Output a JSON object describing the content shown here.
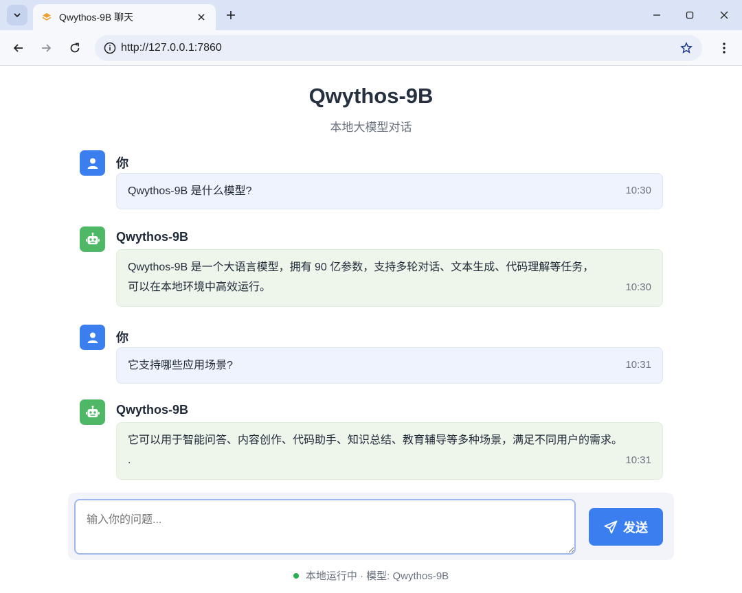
{
  "browser": {
    "tab_title": "Qwythos-9B 聊天",
    "url": "http://127.0.0.1:7860",
    "icons": {
      "tab_menu": "chevron-down-icon",
      "favicon": "layers-icon",
      "tab_close": "close-icon",
      "new_tab": "plus-icon",
      "minimize": "minimize-icon",
      "maximize": "maximize-icon",
      "close_window": "close-icon",
      "back": "arrow-left-icon",
      "forward": "arrow-right-icon",
      "reload": "reload-icon",
      "site_info": "info-icon",
      "bookmark": "star-icon",
      "menu": "more-vertical-icon"
    }
  },
  "header": {
    "title": "Qwythos-9B",
    "subtitle": "本地大模型对话"
  },
  "messages": [
    {
      "role": "user",
      "sender": "你",
      "lines": [
        "Qwythos-9B 是什么模型?"
      ],
      "time": "10:30"
    },
    {
      "role": "bot",
      "sender": "Qwythos-9B",
      "lines": [
        "Qwythos-9B 是一个大语言模型，拥有 90 亿参数，支持多轮对话、文本生成、代码理解等任务，",
        "可以在本地环境中高效运行。"
      ],
      "time": "10:30"
    },
    {
      "role": "user",
      "sender": "你",
      "lines": [
        "它支持哪些应用场景?"
      ],
      "time": "10:31"
    },
    {
      "role": "bot",
      "sender": "Qwythos-9B",
      "lines": [
        "它可以用于智能问答、内容创作、代码助手、知识总结、教育辅导等多种场景，满足不同用户的需求。",
        "."
      ],
      "time": "10:31"
    }
  ],
  "composer": {
    "placeholder": "输入你的问题...",
    "send_label": "发送"
  },
  "status": {
    "text": "本地运行中 · 模型: Qwythos-9B",
    "indicator_color": "#22b14c"
  },
  "colors": {
    "accent": "#3b7ef0",
    "bot_avatar": "#4fb866",
    "user_bubble": "#eff3fd",
    "bot_bubble": "#eef6ec"
  }
}
